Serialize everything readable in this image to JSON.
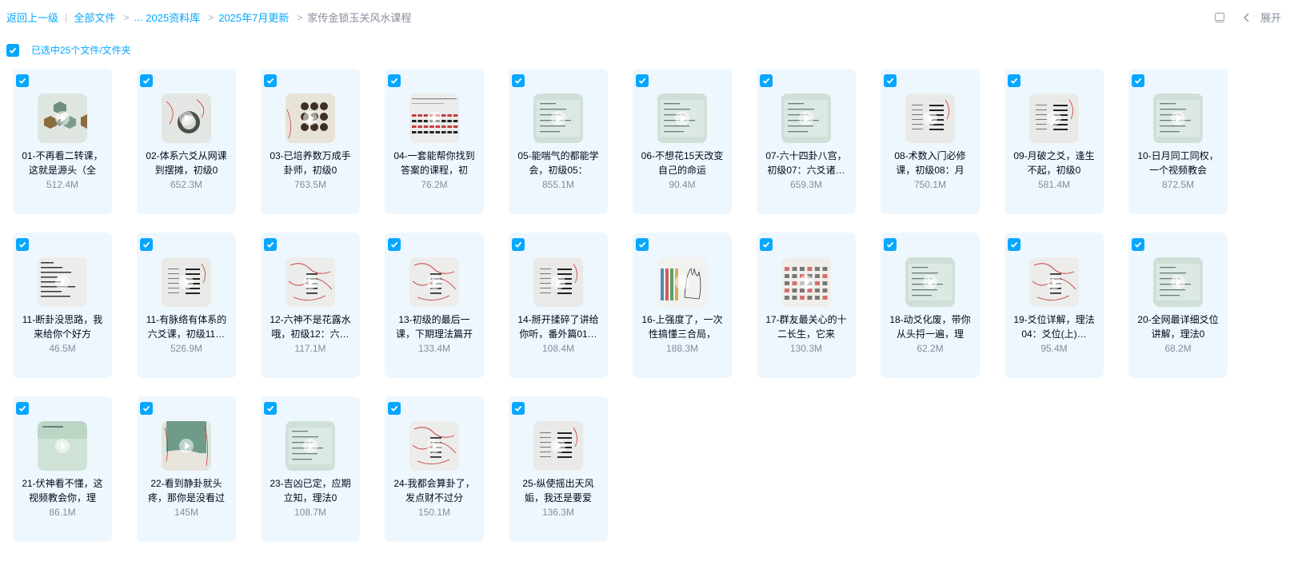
{
  "breadcrumb": {
    "back": "返回上一级",
    "divider": "|",
    "all_files": "全部文件",
    "ellipsis": "...",
    "crumb1": "2025资料库",
    "crumb2": "2025年7月更新",
    "current": "家传金锁玉关风水课程"
  },
  "toolbar": {
    "expand_label": "展开",
    "sidebar_icon": "panel-icon",
    "chevron_icon": "chevron-left-icon"
  },
  "selection": {
    "label": "已选中25个文件/文件夹",
    "checkbox_icon": "checkbox-checked-icon"
  },
  "colors": {
    "accent": "#06a7ff",
    "card_bg": "#eef7fe",
    "text": "#03081a",
    "muted": "#878c9c"
  },
  "files": [
    {
      "name": "01-不再看二转课，这就是源头（全",
      "size": "512.4M",
      "thumb": "hex"
    },
    {
      "name": "02-体系六爻从网课到摆摊，初级0",
      "size": "652.3M",
      "thumb": "circle"
    },
    {
      "name": "03-已培养数万成手卦师，初级0",
      "size": "763.5M",
      "thumb": "dots"
    },
    {
      "name": "04-一套能帮你找到答案的课程，初",
      "size": "76.2M",
      "thumb": "bars"
    },
    {
      "name": "05-能喘气的都能学会，初级05：",
      "size": "855.1M",
      "thumb": "table"
    },
    {
      "name": "06-不想花15天改变自己的命运",
      "size": "90.4M",
      "thumb": "table"
    },
    {
      "name": "07-六十四卦八宫，初级07：六爻诸…",
      "size": "659.3M",
      "thumb": "table"
    },
    {
      "name": "08-术数入门必修课，初级08：月",
      "size": "750.1M",
      "thumb": "lines"
    },
    {
      "name": "09-月破之爻，逢生不起，初级0",
      "size": "581.4M",
      "thumb": "lines"
    },
    {
      "name": "10-日月同工同权，一个视频教会",
      "size": "872.5M",
      "thumb": "table"
    },
    {
      "name": "11-断卦没思路，我来给你个好方",
      "size": "46.5M",
      "thumb": "text"
    },
    {
      "name": "11-有脉络有体系的六爻课，初级11…",
      "size": "526.9M",
      "thumb": "lines"
    },
    {
      "name": "12-六神不是花露水哦，初级12：六…",
      "size": "117.1M",
      "thumb": "scribble"
    },
    {
      "name": "13-初级的最后一课，下期理法篇开",
      "size": "133.4M",
      "thumb": "scribble"
    },
    {
      "name": "14-掰开揉碎了讲给你听，番外篇01…",
      "size": "108.4M",
      "thumb": "lines"
    },
    {
      "name": "16-上强度了，一次性搞懂三合局，",
      "size": "188.3M",
      "thumb": "hand"
    },
    {
      "name": "17-群友最关心的十二长生，它来",
      "size": "130.3M",
      "thumb": "grid"
    },
    {
      "name": "18-动爻化废，带你从头捋一遍，理",
      "size": "62.2M",
      "thumb": "table"
    },
    {
      "name": "19-爻位详解，理法04：爻位(上)…",
      "size": "95.4M",
      "thumb": "scribble"
    },
    {
      "name": "20-全网最详细爻位讲解，理法0",
      "size": "68.2M",
      "thumb": "table"
    },
    {
      "name": "21-伏神看不懂，这视频教会你，理",
      "size": "86.1M",
      "thumb": "green"
    },
    {
      "name": "22-看到静卦就头疼，那你是没看过",
      "size": "145M",
      "thumb": "cover"
    },
    {
      "name": "23-吉凶已定，应期立知，理法0",
      "size": "108.7M",
      "thumb": "table"
    },
    {
      "name": "24-我都会算卦了，发点财不过分",
      "size": "150.1M",
      "thumb": "scribble"
    },
    {
      "name": "25-纵使摇出天风姤，我还是要爱",
      "size": "136.3M",
      "thumb": "lines"
    }
  ]
}
